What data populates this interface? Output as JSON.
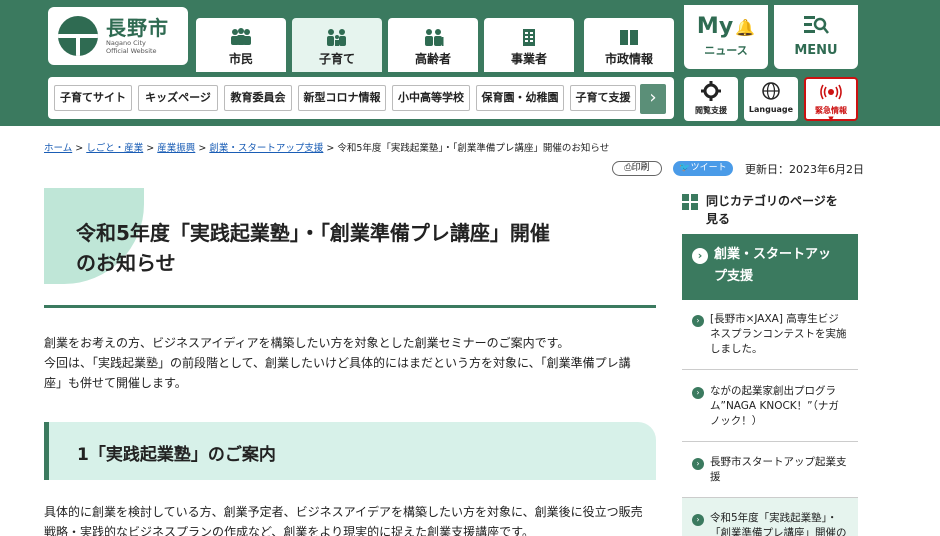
{
  "header": {
    "logo_city": "長野市",
    "logo_en_line1": "Nagano City",
    "logo_en_line2": "Official Website",
    "nav_tabs": [
      {
        "label": "市民",
        "icon": "people-icon"
      },
      {
        "label": "子育て",
        "icon": "family-icon"
      },
      {
        "label": "高齢者",
        "icon": "elderly-icon"
      },
      {
        "label": "事業者",
        "icon": "building-icon"
      },
      {
        "label": "市政情報",
        "icon": "book-icon"
      }
    ],
    "my_news_top": "My",
    "my_news_bottom": "ニュース",
    "menu_label": "MENU",
    "sub_nav": [
      "子育てサイト",
      "キッズページ",
      "教育委員会",
      "新型コロナ情報",
      "小中高等学校",
      "保育園・幼稚園",
      "子育て支援"
    ],
    "util": {
      "accessibility": "閲覧支援",
      "language": "Language",
      "emergency": "緊急情報"
    }
  },
  "breadcrumb": {
    "links": [
      "ホーム",
      "しごと・産業",
      "産業振興",
      "創業・スタートアップ支援"
    ],
    "separator": ">",
    "current": "令和5年度「実践起業塾」・「創業準備プレ講座」開催のお知らせ"
  },
  "tools": {
    "print": "印刷",
    "tweet": "ツイート",
    "updated": "更新日：2023年6月2日"
  },
  "main": {
    "title_line1": "令和5年度「実践起業塾」・「創業準備プレ講座」開催",
    "title_line2": "のお知らせ",
    "intro_line1": "創業をお考えの方、ビジネスアイディアを構築したい方を対象とした創業セミナーのご案内です。",
    "intro_line2": "今回は、「実践起業塾」の前段階として、創業したいけど具体的にはまだという方を対象に、「創業準備プレ講",
    "intro_line3": "座」も併せて開催します。",
    "section1_heading": "1「実践起業塾」のご案内",
    "section1_line1": "具体的に創業を検討している方、創業予定者、ビジネスアイデアを構築したい方を対象に、創業後に役立つ販売",
    "section1_line2": "戦略・実践的なビジネスプランの作成など、創業をより現実的に捉えた創業支援講座です。"
  },
  "sidebar": {
    "heading_line1": "同じカテゴリのページを",
    "heading_line2": "見る",
    "category_line1": "創業・スタートアッ",
    "category_line2": "プ支援",
    "links": [
      {
        "lines": [
          "[長野市×JAXA] 高専生ビジ",
          "ネスプランコンテストを実施",
          "しました。"
        ]
      },
      {
        "lines": [
          "ながの起業家創出プログラ",
          "ム”NAGA KNOCK！”（ナガ",
          "ノック！）"
        ]
      },
      {
        "lines": [
          "長野市スタートアップ起業支",
          "援"
        ]
      },
      {
        "lines": [
          "令和5年度「実践起業塾」・",
          "「創業準備プレ講座」開催の"
        ]
      }
    ]
  },
  "colors": {
    "brand_green": "#3b7a5f",
    "mint": "#d7f1e9",
    "link_blue": "#1a5db5",
    "alert_red": "#cc1111"
  }
}
